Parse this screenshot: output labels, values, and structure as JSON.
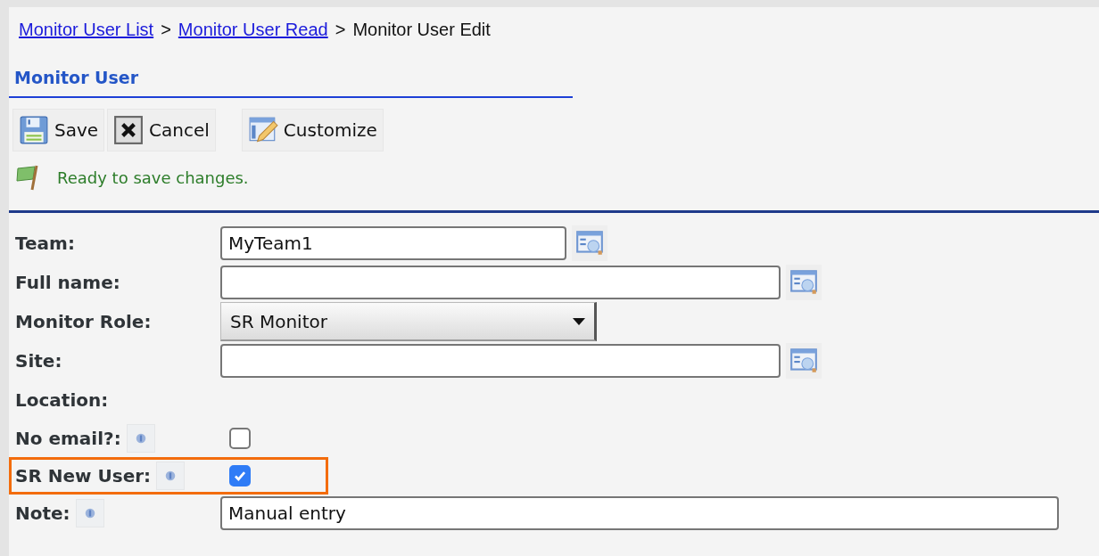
{
  "breadcrumb": [
    {
      "label": "Monitor User List",
      "link": true
    },
    {
      "label": ">",
      "link": false
    },
    {
      "label": "Monitor User Read",
      "link": true
    },
    {
      "label": ">",
      "link": false
    },
    {
      "label": "Monitor User Edit",
      "link": false
    }
  ],
  "section_title": "Monitor User",
  "toolbar": [
    {
      "label": "Save",
      "kind": "save"
    },
    {
      "label": "Cancel",
      "kind": "cancel"
    },
    {
      "label": "Customize",
      "kind": "customize"
    }
  ],
  "status_message": "Ready to save changes.",
  "fields": [
    {
      "label": "Team:",
      "kind": "text",
      "value": "MyTeam1",
      "lookup": true,
      "help": false,
      "highlighted": false
    },
    {
      "label": "Full name:",
      "kind": "text",
      "lookup": true,
      "help": false,
      "highlighted": false
    },
    {
      "label": "Monitor Role:",
      "kind": "select",
      "value": "SR Monitor",
      "help": false,
      "highlighted": false
    },
    {
      "label": "Site:",
      "kind": "text",
      "lookup": true,
      "help": false,
      "highlighted": false
    },
    {
      "label": "Location:",
      "kind": "none",
      "help": false,
      "highlighted": false
    },
    {
      "label": "No email?:",
      "kind": "checkbox",
      "checked": false,
      "help": true,
      "highlighted": false
    },
    {
      "label": "SR New User:",
      "kind": "checkbox",
      "checked": true,
      "help": true,
      "highlighted": true
    },
    {
      "label": "Note:",
      "kind": "text",
      "value": "Manual entry",
      "lookup": false,
      "help": true,
      "highlighted": false
    }
  ]
}
